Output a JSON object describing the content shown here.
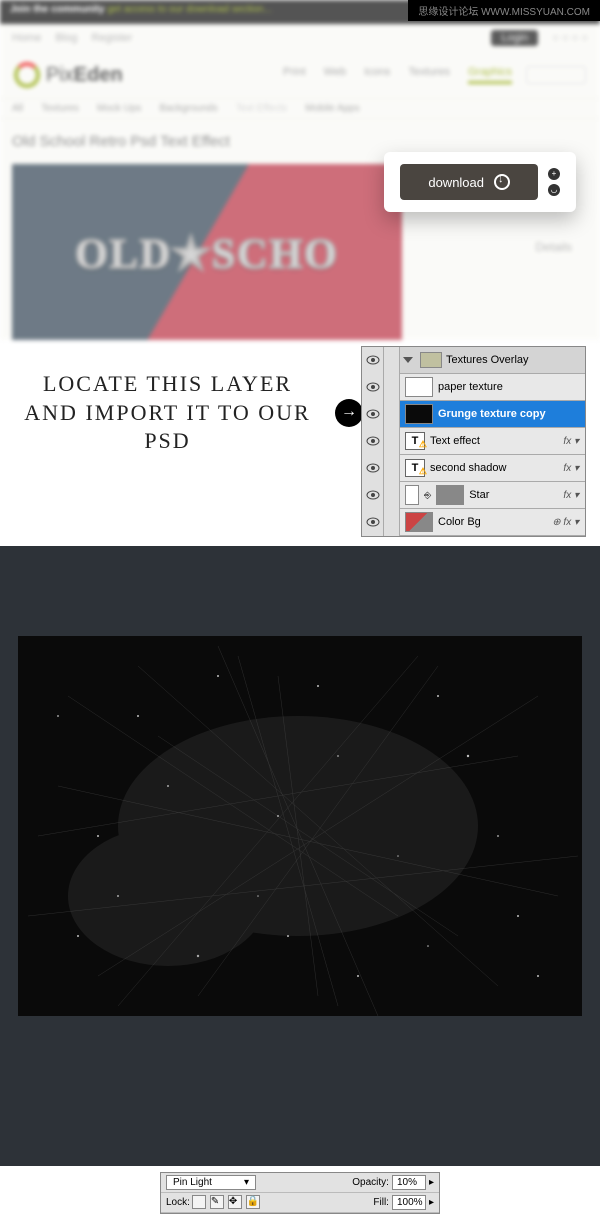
{
  "watermark": "思缘设计论坛 WWW.MISSYUAN.COM",
  "topbar": {
    "bold": "Join the community",
    "rest": " get access to our download section..."
  },
  "logo": {
    "a": "Pix",
    "b": "Eden"
  },
  "tabs": [
    "Print",
    "Web",
    "Icons",
    "Textures",
    "Graphics"
  ],
  "crumbs": [
    "All",
    "Textures",
    "Mock Ups",
    "Backgrounds",
    "Text Effects",
    "Mobile Apps"
  ],
  "pageTitle": "Old School Retro Psd Text Effect",
  "heroText": "OLD★SCHO",
  "download": "download",
  "instruction": "LOCATE THIS LAYER AND IMPORT IT TO OUR PSD",
  "layers": {
    "group": "Textures Overlay",
    "items": [
      {
        "name": "paper texture",
        "thumb": "white",
        "fx": false
      },
      {
        "name": "Grunge texture copy",
        "thumb": "bk",
        "fx": false,
        "sel": true
      },
      {
        "name": "Text effect",
        "thumb": "T",
        "fx": true
      },
      {
        "name": "second shadow",
        "thumb": "T",
        "fx": true
      },
      {
        "name": "Star",
        "thumb": "grey",
        "fx": true
      },
      {
        "name": "Color Bg",
        "thumb": "half",
        "fx": true
      }
    ]
  },
  "opts": {
    "blendLabel": "Pin Light",
    "opacityLabel": "Opacity:",
    "opacityVal": "10%",
    "lockLabel": "Lock:",
    "fillLabel": "Fill:",
    "fillVal": "100%"
  }
}
